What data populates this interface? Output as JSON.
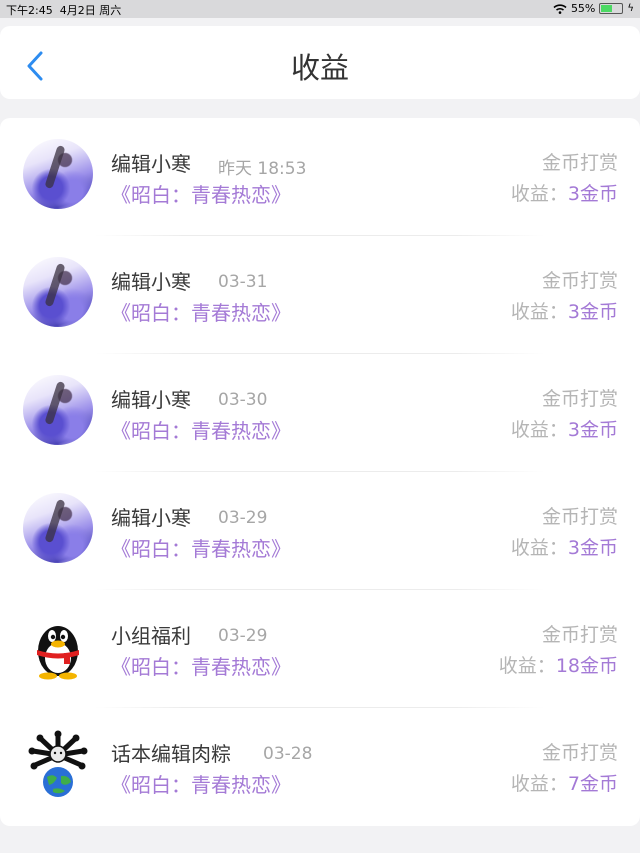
{
  "status_bar": {
    "time": "下午2:45",
    "date": "4月2日 周六",
    "battery": "55%",
    "wifi_icon": "wifi-icon",
    "battery_level": 0.55
  },
  "header": {
    "title": "收益",
    "back_icon": "chevron-left-icon"
  },
  "items": [
    {
      "name": "编辑小寒",
      "time": "昨天 18:53",
      "work": "《昭白：青春热恋》",
      "type": "金币打赏",
      "income_label": "收益：",
      "income_amount": "3金币",
      "avatar": "anime-art-avatar"
    },
    {
      "name": "编辑小寒",
      "time": "03-31",
      "work": "《昭白：青春热恋》",
      "type": "金币打赏",
      "income_label": "收益：",
      "income_amount": "3金币",
      "avatar": "anime-art-avatar"
    },
    {
      "name": "编辑小寒",
      "time": "03-30",
      "work": "《昭白：青春热恋》",
      "type": "金币打赏",
      "income_label": "收益：",
      "income_amount": "3金币",
      "avatar": "anime-art-avatar"
    },
    {
      "name": "编辑小寒",
      "time": "03-29",
      "work": "《昭白：青春热恋》",
      "type": "金币打赏",
      "income_label": "收益：",
      "income_amount": "3金币",
      "avatar": "anime-art-avatar"
    },
    {
      "name": "小组福利",
      "time": "03-29",
      "work": "《昭白：青春热恋》",
      "type": "金币打赏",
      "income_label": "收益：",
      "income_amount": "18金币",
      "avatar": "penguin-avatar"
    },
    {
      "name": "话本编辑肉粽",
      "time": "03-28",
      "work": "《昭白：青春热恋》",
      "type": "金币打赏",
      "income_label": "收益：",
      "income_amount": "7金币",
      "avatar": "globe-octopus-avatar"
    }
  ],
  "colors": {
    "accent": "#a47ad6",
    "back": "#2d8cf0",
    "muted": "#b5b5b5"
  }
}
